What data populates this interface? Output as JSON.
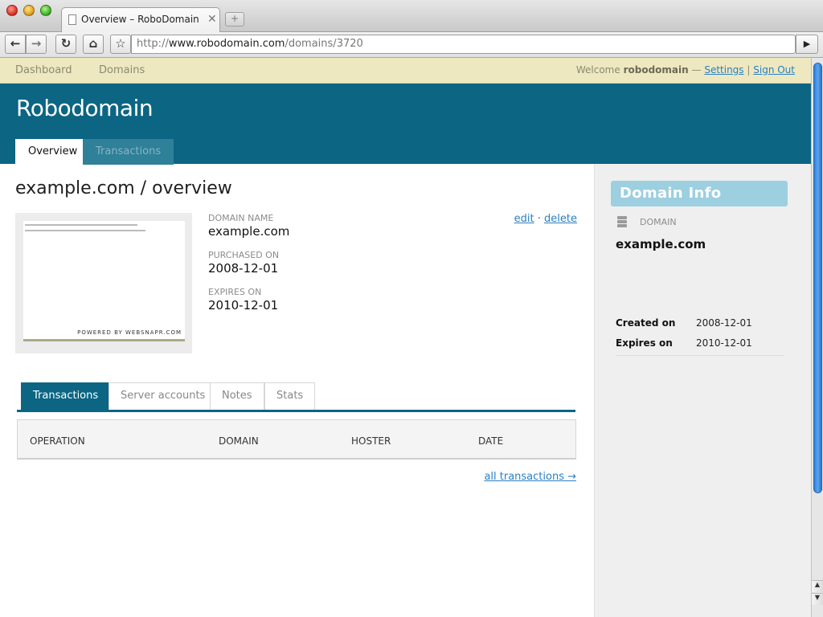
{
  "browser": {
    "tab_title": "Overview – RoboDomain",
    "url_prefix": "http://",
    "url_host": "www.robodomain.com",
    "url_path": "/domains/3720"
  },
  "topnav": {
    "dashboard": "Dashboard",
    "domains": "Domains",
    "welcome_prefix": "Welcome",
    "username": "robodomain",
    "dash": "—",
    "settings": "Settings",
    "sep": "|",
    "sign_out": "Sign Out"
  },
  "header": {
    "logo": "Robodomain",
    "tabs": [
      {
        "label": "Overview",
        "active": true
      },
      {
        "label": "Transactions",
        "active": false
      }
    ]
  },
  "main": {
    "title": "example.com / overview",
    "thumbnail_credit": "POWERED BY WEBSNAPR.COM",
    "fields": [
      {
        "label": "Domain name",
        "value": "example.com"
      },
      {
        "label": "Purchased on",
        "value": "2008-12-01"
      },
      {
        "label": "Expires on",
        "value": "2010-12-01"
      }
    ],
    "actions": {
      "edit": "edit",
      "dot": "·",
      "delete": "delete"
    },
    "subtabs": [
      "Transactions",
      "Server accounts",
      "Notes",
      "Stats"
    ],
    "table_headers": [
      "OPERATION",
      "DOMAIN",
      "HOSTER",
      "DATE"
    ],
    "all_transactions": "all transactions →"
  },
  "sidebar": {
    "title": "Domain Info",
    "section_label": "Domain",
    "domain": "example.com",
    "rows": [
      {
        "label": "Created on",
        "value": "2008-12-01"
      },
      {
        "label": "Expires on",
        "value": "2010-12-01"
      }
    ]
  },
  "colors": {
    "header": "#0b6583",
    "topnav": "#ede8c0",
    "link": "#2a7fc4",
    "sidebar_title": "#9ccfdf"
  }
}
